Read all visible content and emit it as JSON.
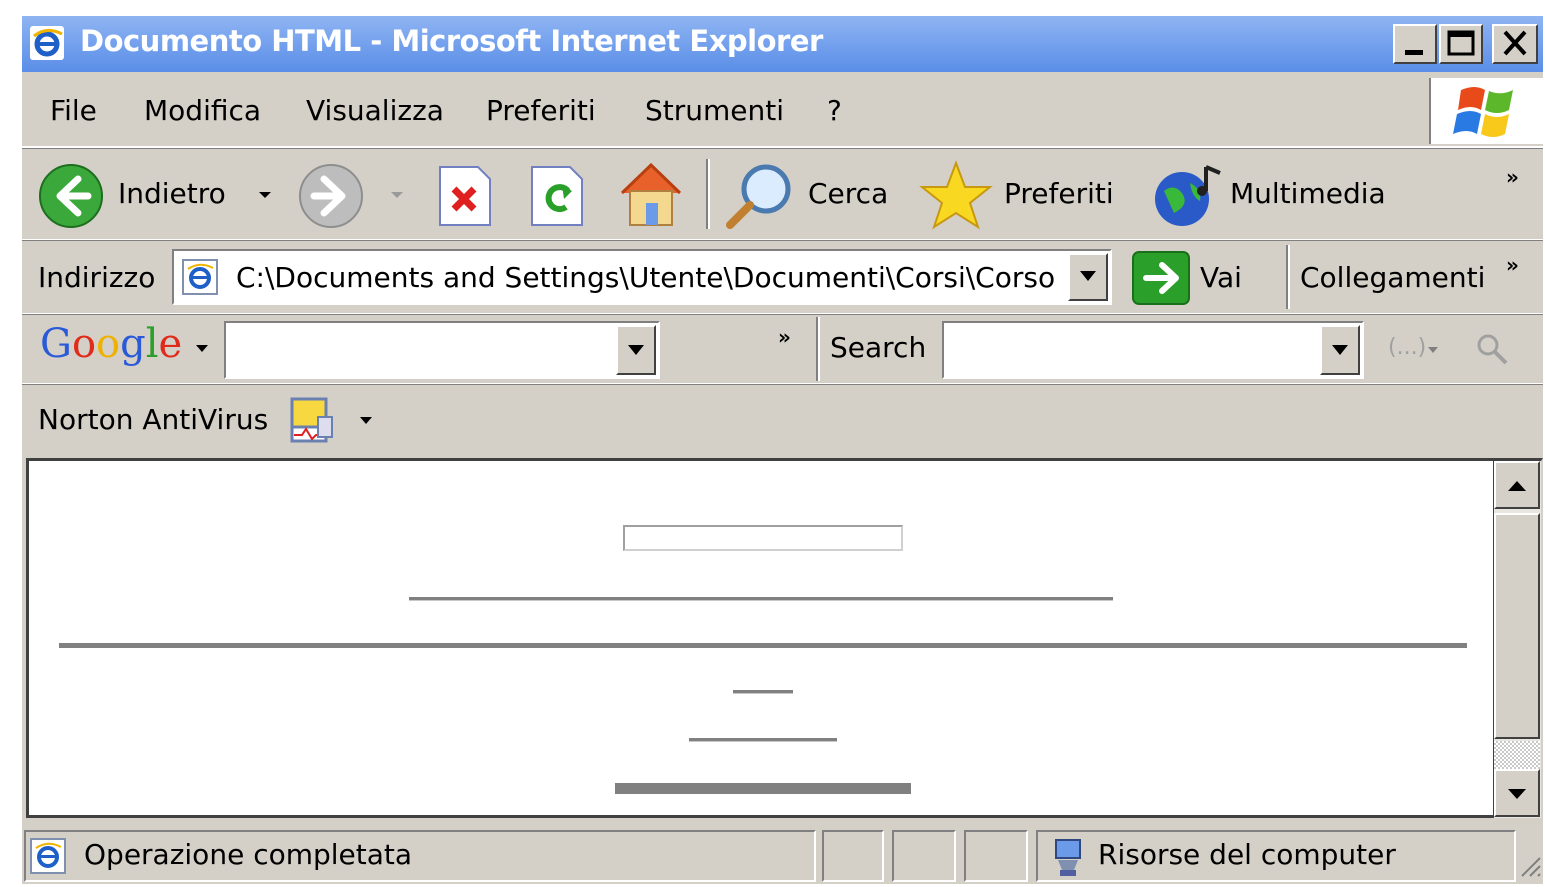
{
  "window": {
    "title": "Documento HTML - Microsoft Internet Explorer"
  },
  "menu": [
    "File",
    "Modifica",
    "Visualizza",
    "Preferiti",
    "Strumenti",
    "?"
  ],
  "toolbar": {
    "back_label": "Indietro",
    "search_label": "Cerca",
    "favorites_label": "Preferiti",
    "media_label": "Multimedia",
    "more": "»"
  },
  "address": {
    "label": "Indirizzo",
    "value": "C:\\Documents and Settings\\Utente\\Documenti\\Corsi\\Corso",
    "go_label": "Vai",
    "links_label": "Collegamenti",
    "more": "»"
  },
  "google": {
    "logo": "Google",
    "more": "»",
    "search_label": "Search",
    "highlight_label": "(...)"
  },
  "norton": {
    "label": "Norton AntiVirus"
  },
  "status": {
    "text": "Operazione completata",
    "zone": "Risorse del computer"
  },
  "colors": {
    "titlebar": "#6a9ae8",
    "chrome": "#d4d0c8",
    "rule": "#808080"
  }
}
